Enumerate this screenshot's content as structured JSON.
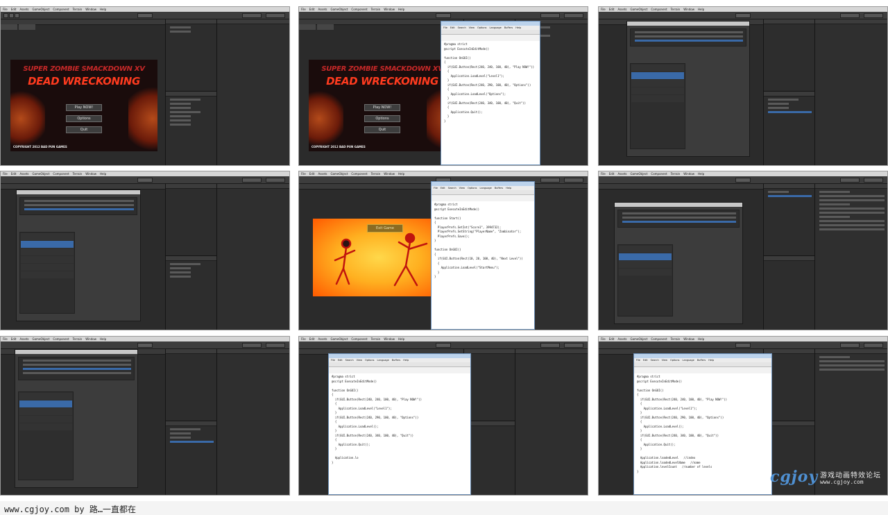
{
  "unity_menu": [
    "File",
    "Edit",
    "Assets",
    "GameObject",
    "Component",
    "Terrain",
    "Window",
    "Help"
  ],
  "editor_menu": [
    "File",
    "Edit",
    "Search",
    "View",
    "Options",
    "Language",
    "Buffers",
    "Help"
  ],
  "game": {
    "title_line1": "SUPER ZOMBIE SMACKDOWN XV",
    "title_line2": "DEAD WRECKONING",
    "buttons": [
      "Play NOW!",
      "Options",
      "Quit"
    ],
    "copyright": "COPYRIGHT 2012 BAD PUN GAMES"
  },
  "code_frame2": [
    "#pragma strict",
    "@script ExecuteInEditMode()",
    "",
    "function OnGUI()",
    "{",
    "  if(GUI.Button(Rect(240, 240, 100, 40), \"Play NOW!\"))",
    "  {",
    "    Application.LoadLevel(\"Level1\");",
    "  }",
    "  if(GUI.Button(Rect(240, 290, 100, 40), \"Options\"))",
    "  {",
    "    Application.LoadLevel(\"Options\");",
    "  }",
    "  if(GUI.Button(Rect(240, 340, 100, 40), \"Quit\"))",
    "  {",
    "    Application.Quit();",
    "  }",
    "}"
  ],
  "code_frame5": [
    "#pragma strict",
    "@script ExecuteInEditMode()",
    "",
    "function Start()",
    "{",
    "  PlayerPrefs.SetInt(\"Score1\", 3994732);",
    "  PlayerPrefs.SetString(\"PlayerName\", \"Zombinator\");",
    "  PlayerPrefs.Save();",
    "}",
    "",
    "function OnGUI()",
    "{",
    "  if(GUI.Button(Rect(10, 20, 100, 40), \"Next Level\"))",
    "  {",
    "    Application.LoadLevel(\"StartMenu\");",
    "  }",
    "}"
  ],
  "code_frame8": [
    "#pragma strict",
    "@script ExecuteInEditMode()",
    "",
    "function OnGUI()",
    "{",
    "  if(GUI.Button(Rect(240, 240, 100, 40), \"Play NOW!\"))",
    "  {",
    "    Application.LoadLevel(\"Level1\");",
    "  }",
    "  if(GUI.Button(Rect(240, 290, 100, 40), \"Options\"))",
    "  {",
    "    Application.LoadLevel();",
    "  }",
    "  if(GUI.Button(Rect(240, 340, 100, 40), \"Quit\"))",
    "  {",
    "    Application.Quit();",
    "  }",
    "",
    "  Application.lo",
    "}"
  ],
  "code_frame9": [
    "#pragma strict",
    "@script ExecuteInEditMode()",
    "",
    "function OnGUI()",
    "{",
    "  if(GUI.Button(Rect(240, 240, 100, 40), \"Play NOW!\"))",
    "  {",
    "    Application.LoadLevel(\"Level1\");",
    "  }",
    "  if(GUI.Button(Rect(240, 290, 100, 40), \"Options\"))",
    "  {",
    "    Application.LoadLevel();",
    "  }",
    "  if(GUI.Button(Rect(240, 340, 100, 40), \"Quit\"))",
    "  {",
    "    Application.Quit();",
    "  }",
    "",
    "  Application.loadedLevel   //index",
    "  Application.loadedLevelName   //name",
    "  Application.levelCount   //number of levels",
    "}"
  ],
  "stick_button": "Exit Game",
  "watermark": {
    "logo": "cgjoy",
    "chinese": "游戏动画特效论坛",
    "url": "www.cgjoy.com"
  },
  "footer": "www.cgjoy.com by 路…一直都在"
}
